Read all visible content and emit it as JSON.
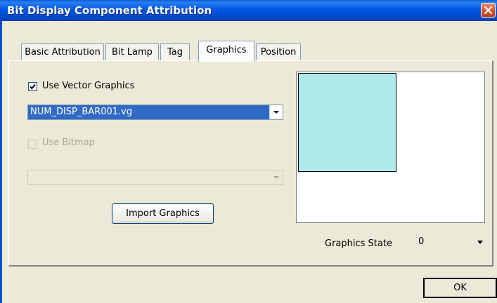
{
  "window": {
    "title": "Bit Display Component Attribution",
    "close_icon": "close-icon"
  },
  "tabs": [
    {
      "label": "Basic Attribution",
      "active": false
    },
    {
      "label": "Bit Lamp",
      "active": false
    },
    {
      "label": "Tag",
      "active": false
    },
    {
      "label": "Graphics",
      "active": true
    },
    {
      "label": "Position",
      "active": false
    }
  ],
  "graphics": {
    "use_vector_label": "Use Vector Graphics",
    "use_vector_checked": true,
    "vector_file": "NUM_DISP_BAR001.vg",
    "use_bitmap_label": "Use Bitmap",
    "use_bitmap_checked": false,
    "use_bitmap_enabled": false,
    "bitmap_file": "",
    "import_label": "Import Graphics",
    "state_label": "Graphics State",
    "state_value": "0",
    "preview_fill_color": "#aeeaec"
  },
  "footer": {
    "ok_label": "OK"
  }
}
